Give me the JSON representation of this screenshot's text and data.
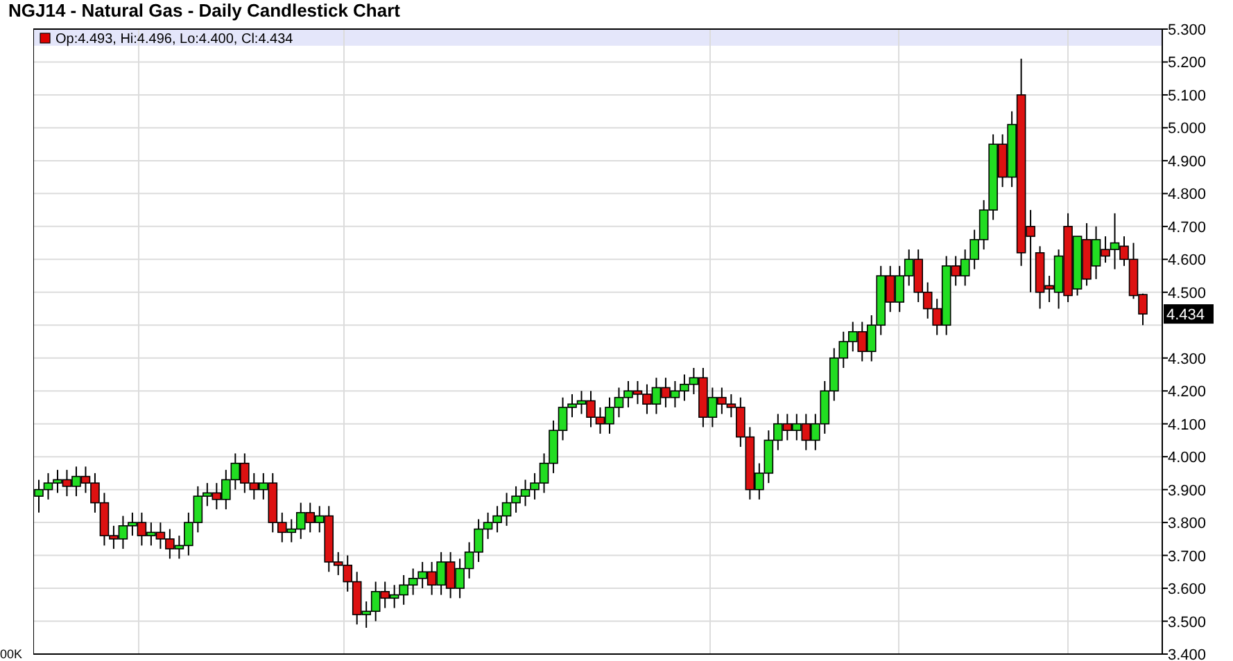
{
  "title": "NGJ14 - Natural Gas - Daily Candlestick Chart",
  "legend": {
    "text": "Op:4.493, Hi:4.496, Lo:4.400, Cl:4.434",
    "color": "#dd0000"
  },
  "chart_data": {
    "type": "candlestick",
    "grid": true,
    "ylim": [
      3.4,
      5.3
    ],
    "yticks": [
      {
        "value": 5.3,
        "label": "5.300"
      },
      {
        "value": 5.2,
        "label": "5.200"
      },
      {
        "value": 5.1,
        "label": "5.100"
      },
      {
        "value": 5.0,
        "label": "5.000"
      },
      {
        "value": 4.9,
        "label": "4.900"
      },
      {
        "value": 4.8,
        "label": "4.800"
      },
      {
        "value": 4.7,
        "label": "4.700"
      },
      {
        "value": 4.6,
        "label": "4.600"
      },
      {
        "value": 4.5,
        "label": "4.500"
      },
      {
        "value": 4.3,
        "label": "4.300"
      },
      {
        "value": 4.2,
        "label": "4.200"
      },
      {
        "value": 4.1,
        "label": "4.100"
      },
      {
        "value": 4.0,
        "label": "4.000"
      },
      {
        "value": 3.9,
        "label": "3.900"
      },
      {
        "value": 3.8,
        "label": "3.800"
      },
      {
        "value": 3.7,
        "label": "3.700"
      },
      {
        "value": 3.6,
        "label": "3.600"
      },
      {
        "value": 3.5,
        "label": "3.500"
      },
      {
        "value": 3.4,
        "label": "3.400"
      }
    ],
    "ohlc": [
      [
        3.88,
        3.93,
        3.83,
        3.9
      ],
      [
        3.9,
        3.95,
        3.87,
        3.92
      ],
      [
        3.92,
        3.96,
        3.89,
        3.93
      ],
      [
        3.93,
        3.96,
        3.88,
        3.91
      ],
      [
        3.91,
        3.97,
        3.88,
        3.94
      ],
      [
        3.94,
        3.97,
        3.89,
        3.92
      ],
      [
        3.92,
        3.95,
        3.83,
        3.86
      ],
      [
        3.86,
        3.89,
        3.73,
        3.76
      ],
      [
        3.76,
        3.79,
        3.72,
        3.75
      ],
      [
        3.75,
        3.82,
        3.72,
        3.79
      ],
      [
        3.79,
        3.83,
        3.76,
        3.8
      ],
      [
        3.8,
        3.83,
        3.73,
        3.76
      ],
      [
        3.76,
        3.8,
        3.73,
        3.77
      ],
      [
        3.77,
        3.8,
        3.72,
        3.75
      ],
      [
        3.75,
        3.78,
        3.69,
        3.72
      ],
      [
        3.72,
        3.76,
        3.69,
        3.73
      ],
      [
        3.73,
        3.83,
        3.7,
        3.8
      ],
      [
        3.8,
        3.91,
        3.77,
        3.88
      ],
      [
        3.88,
        3.92,
        3.85,
        3.89
      ],
      [
        3.89,
        3.92,
        3.84,
        3.87
      ],
      [
        3.87,
        3.96,
        3.84,
        3.93
      ],
      [
        3.93,
        4.01,
        3.9,
        3.98
      ],
      [
        3.98,
        4.01,
        3.89,
        3.92
      ],
      [
        3.92,
        3.95,
        3.87,
        3.9
      ],
      [
        3.9,
        3.95,
        3.87,
        3.92
      ],
      [
        3.92,
        3.95,
        3.77,
        3.8
      ],
      [
        3.8,
        3.83,
        3.74,
        3.77
      ],
      [
        3.77,
        3.81,
        3.74,
        3.78
      ],
      [
        3.78,
        3.86,
        3.75,
        3.83
      ],
      [
        3.83,
        3.86,
        3.77,
        3.8
      ],
      [
        3.8,
        3.85,
        3.77,
        3.82
      ],
      [
        3.82,
        3.85,
        3.65,
        3.68
      ],
      [
        3.68,
        3.71,
        3.64,
        3.67
      ],
      [
        3.67,
        3.7,
        3.59,
        3.62
      ],
      [
        3.62,
        3.65,
        3.49,
        3.52
      ],
      [
        3.52,
        3.56,
        3.48,
        3.53
      ],
      [
        3.53,
        3.62,
        3.5,
        3.59
      ],
      [
        3.59,
        3.62,
        3.54,
        3.57
      ],
      [
        3.57,
        3.61,
        3.54,
        3.58
      ],
      [
        3.58,
        3.64,
        3.55,
        3.61
      ],
      [
        3.61,
        3.66,
        3.58,
        3.63
      ],
      [
        3.63,
        3.68,
        3.6,
        3.65
      ],
      [
        3.65,
        3.68,
        3.58,
        3.61
      ],
      [
        3.61,
        3.71,
        3.58,
        3.68
      ],
      [
        3.68,
        3.71,
        3.57,
        3.6
      ],
      [
        3.6,
        3.69,
        3.57,
        3.66
      ],
      [
        3.66,
        3.74,
        3.63,
        3.71
      ],
      [
        3.71,
        3.81,
        3.68,
        3.78
      ],
      [
        3.78,
        3.83,
        3.75,
        3.8
      ],
      [
        3.8,
        3.85,
        3.77,
        3.82
      ],
      [
        3.82,
        3.89,
        3.79,
        3.86
      ],
      [
        3.86,
        3.91,
        3.83,
        3.88
      ],
      [
        3.88,
        3.93,
        3.85,
        3.9
      ],
      [
        3.9,
        3.95,
        3.87,
        3.92
      ],
      [
        3.92,
        4.01,
        3.89,
        3.98
      ],
      [
        3.98,
        4.11,
        3.95,
        4.08
      ],
      [
        4.08,
        4.18,
        4.05,
        4.15
      ],
      [
        4.15,
        4.19,
        4.12,
        4.16
      ],
      [
        4.16,
        4.2,
        4.13,
        4.17
      ],
      [
        4.17,
        4.2,
        4.09,
        4.12
      ],
      [
        4.12,
        4.15,
        4.07,
        4.1
      ],
      [
        4.1,
        4.18,
        4.07,
        4.15
      ],
      [
        4.15,
        4.21,
        4.12,
        4.18
      ],
      [
        4.18,
        4.23,
        4.15,
        4.2
      ],
      [
        4.2,
        4.23,
        4.16,
        4.19
      ],
      [
        4.19,
        4.22,
        4.13,
        4.16
      ],
      [
        4.16,
        4.24,
        4.13,
        4.21
      ],
      [
        4.21,
        4.24,
        4.15,
        4.18
      ],
      [
        4.18,
        4.23,
        4.15,
        4.2
      ],
      [
        4.2,
        4.25,
        4.17,
        4.22
      ],
      [
        4.22,
        4.27,
        4.19,
        4.24
      ],
      [
        4.24,
        4.27,
        4.09,
        4.12
      ],
      [
        4.12,
        4.21,
        4.09,
        4.18
      ],
      [
        4.18,
        4.21,
        4.13,
        4.16
      ],
      [
        4.16,
        4.19,
        4.12,
        4.15
      ],
      [
        4.15,
        4.18,
        4.03,
        4.06
      ],
      [
        4.06,
        4.09,
        3.87,
        3.9
      ],
      [
        3.9,
        3.98,
        3.87,
        3.95
      ],
      [
        3.95,
        4.08,
        3.92,
        4.05
      ],
      [
        4.05,
        4.13,
        4.02,
        4.1
      ],
      [
        4.1,
        4.13,
        4.05,
        4.08
      ],
      [
        4.08,
        4.13,
        4.05,
        4.1
      ],
      [
        4.1,
        4.13,
        4.02,
        4.05
      ],
      [
        4.05,
        4.13,
        4.02,
        4.1
      ],
      [
        4.1,
        4.23,
        4.07,
        4.2
      ],
      [
        4.2,
        4.33,
        4.17,
        4.3
      ],
      [
        4.3,
        4.38,
        4.27,
        4.35
      ],
      [
        4.35,
        4.41,
        4.32,
        4.38
      ],
      [
        4.38,
        4.41,
        4.29,
        4.32
      ],
      [
        4.32,
        4.43,
        4.29,
        4.4
      ],
      [
        4.4,
        4.58,
        4.37,
        4.55
      ],
      [
        4.55,
        4.58,
        4.44,
        4.47
      ],
      [
        4.47,
        4.58,
        4.44,
        4.55
      ],
      [
        4.55,
        4.63,
        4.52,
        4.6
      ],
      [
        4.6,
        4.63,
        4.47,
        4.5
      ],
      [
        4.5,
        4.53,
        4.42,
        4.45
      ],
      [
        4.45,
        4.48,
        4.37,
        4.4
      ],
      [
        4.4,
        4.61,
        4.37,
        4.58
      ],
      [
        4.58,
        4.61,
        4.52,
        4.55
      ],
      [
        4.55,
        4.63,
        4.52,
        4.6
      ],
      [
        4.6,
        4.69,
        4.57,
        4.66
      ],
      [
        4.66,
        4.78,
        4.63,
        4.75
      ],
      [
        4.75,
        4.98,
        4.72,
        4.95
      ],
      [
        4.95,
        4.98,
        4.82,
        4.85
      ],
      [
        4.85,
        5.05,
        4.82,
        5.01
      ],
      [
        5.1,
        5.21,
        4.58,
        4.62
      ],
      [
        4.7,
        4.75,
        4.5,
        4.67
      ],
      [
        4.62,
        4.64,
        4.45,
        4.5
      ],
      [
        4.52,
        4.55,
        4.47,
        4.51
      ],
      [
        4.5,
        4.63,
        4.45,
        4.61
      ],
      [
        4.7,
        4.74,
        4.47,
        4.49
      ],
      [
        4.51,
        4.67,
        4.49,
        4.67
      ],
      [
        4.66,
        4.71,
        4.52,
        4.54
      ],
      [
        4.58,
        4.7,
        4.54,
        4.66
      ],
      [
        4.63,
        4.67,
        4.59,
        4.61
      ],
      [
        4.63,
        4.74,
        4.57,
        4.65
      ],
      [
        4.64,
        4.67,
        4.58,
        4.6
      ],
      [
        4.6,
        4.65,
        4.48,
        4.49
      ],
      [
        4.493,
        4.496,
        4.4,
        4.434
      ]
    ]
  },
  "last_price": "4.434",
  "volume_axis": {
    "label": "00K"
  }
}
